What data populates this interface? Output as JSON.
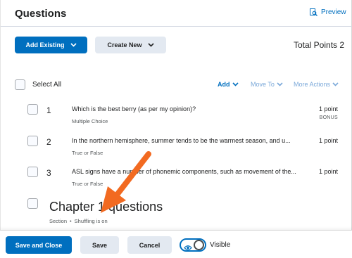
{
  "header": {
    "title": "Questions",
    "preview_label": "Preview"
  },
  "toolbar": {
    "add_existing_label": "Add Existing",
    "create_new_label": "Create New",
    "total_points_label": "Total Points 2"
  },
  "list_actions": {
    "select_all_label": "Select All",
    "add_label": "Add",
    "move_to_label": "Move To",
    "more_actions_label": "More Actions"
  },
  "questions": [
    {
      "number": "1",
      "text": "Which is the best berry (as per my opinion)?",
      "type": "Multiple Choice",
      "points": "1 point",
      "bonus": "BONUS"
    },
    {
      "number": "2",
      "text": "In the northern hemisphere, summer tends to be the warmest season, and u...",
      "type": "True or False",
      "points": "1 point"
    },
    {
      "number": "3",
      "text": "ASL signs have a number of phonemic components, such as movement of the...",
      "type": "True or False",
      "points": "1 point"
    }
  ],
  "section": {
    "title": "Chapter 1 questions",
    "kind": "Section",
    "separator": "•",
    "shuffling": "Shuffling is on"
  },
  "footer": {
    "save_and_close_label": "Save and Close",
    "save_label": "Save",
    "cancel_label": "Cancel",
    "visible_label": "Visible",
    "visible_toggle_on": true
  },
  "colors": {
    "primary": "#006fbf",
    "secondary_button": "#e3e9f1",
    "annotation_arrow": "#f26a21"
  }
}
